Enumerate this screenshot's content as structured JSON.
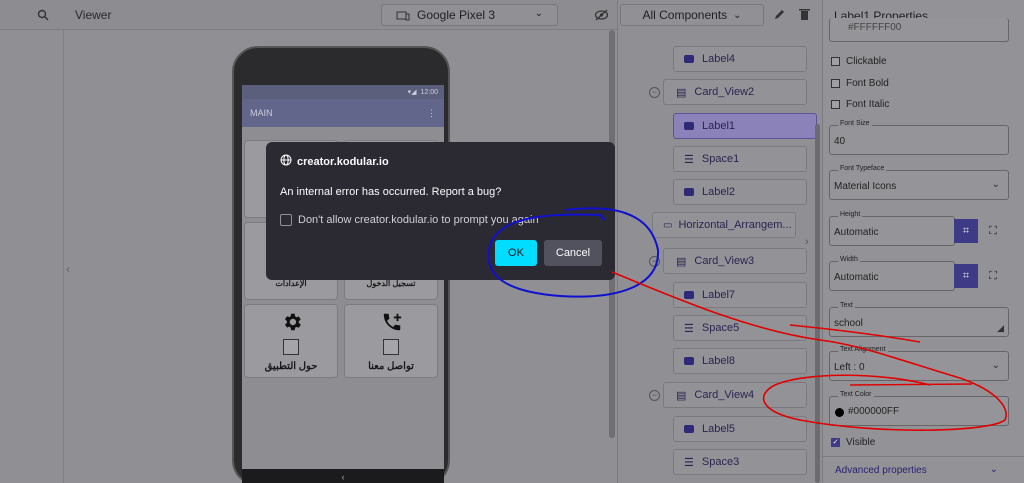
{
  "viewer": {
    "title": "Viewer",
    "device": "Google Pixel 3",
    "status_time": "12:00",
    "app_title": "MAIN",
    "tiles": [
      {
        "label": "حول التطبيق",
        "icon": "gear-icon"
      },
      {
        "label": "تواصل معنا",
        "icon": "phone-add-icon"
      }
    ],
    "partial_tile_texts": [
      "الإعدادات",
      "تسجيل الدخول"
    ]
  },
  "components": {
    "filter": "All Components",
    "nodes": [
      {
        "label": "Label4",
        "type": "label"
      },
      {
        "label": "Card_View2",
        "type": "card"
      },
      {
        "label": "Label1",
        "type": "label",
        "selected": true
      },
      {
        "label": "Space1",
        "type": "space"
      },
      {
        "label": "Label2",
        "type": "label"
      },
      {
        "label": "Horizontal_Arrangem...",
        "type": "arrangement"
      },
      {
        "label": "Card_View3",
        "type": "card"
      },
      {
        "label": "Label7",
        "type": "label"
      },
      {
        "label": "Space5",
        "type": "space"
      },
      {
        "label": "Label8",
        "type": "label"
      },
      {
        "label": "Card_View4",
        "type": "card"
      },
      {
        "label": "Label5",
        "type": "label"
      },
      {
        "label": "Space3",
        "type": "space"
      }
    ]
  },
  "properties": {
    "title": "Label1 Properties",
    "top_value": "#FFFFFF00",
    "checks": [
      {
        "label": "Clickable",
        "checked": false
      },
      {
        "label": "Font Bold",
        "checked": false
      },
      {
        "label": "Font Italic",
        "checked": false
      }
    ],
    "font_size_label": "Font Size",
    "font_size": "40",
    "font_typeface_label": "Font Typeface",
    "font_typeface": "Material Icons",
    "height_label": "Height",
    "height": "Automatic",
    "width_label": "Width",
    "width": "Automatic",
    "text_label": "Text",
    "text": "school",
    "text_alignment_label": "Text Alignment",
    "text_alignment": "Left : 0",
    "text_color_label": "Text Color",
    "text_color": "#000000FF",
    "visible_label": "Visible",
    "visible": true,
    "advanced": "Advanced properties"
  },
  "dialog": {
    "host": "creator.kodular.io",
    "message": "An internal error has occurred. Report a bug?",
    "checkbox": "Don't allow creator.kodular.io to prompt you again",
    "ok": "OK",
    "cancel": "Cancel"
  },
  "colors": {
    "accent": "#00ddff",
    "dialog_bg": "#2b2a33",
    "annotation_blue": "#1010d0",
    "annotation_red": "#e00000"
  }
}
